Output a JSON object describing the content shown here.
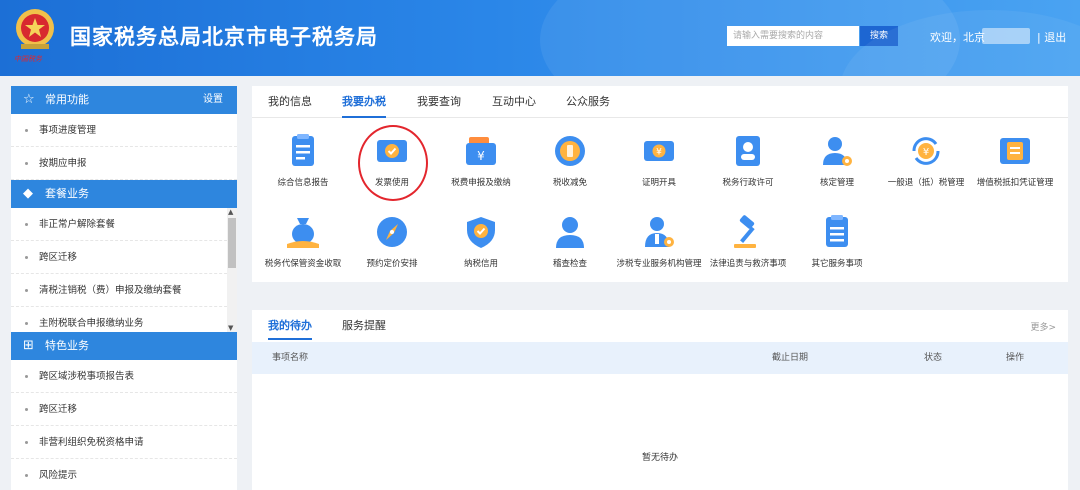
{
  "header": {
    "title": "国家税务总局北京市电子税务局",
    "search_placeholder": "请输入需要搜索的内容",
    "search_button": "搜索",
    "welcome": "欢迎，北京",
    "logout": "| 退出",
    "emblem_caption": "中国税务"
  },
  "sidebar": {
    "sections": [
      {
        "title": "常用功能",
        "icon": "star-icon",
        "setting": "设置",
        "items": [
          "事项进度管理",
          "按期应申报"
        ]
      },
      {
        "title": "套餐业务",
        "icon": "layers-icon",
        "items": [
          "非正常户解除套餐",
          "跨区迁移",
          "清税注销税（费）申报及缴纳套餐",
          "主附税联合申报缴纳业务"
        ]
      },
      {
        "title": "特色业务",
        "icon": "grid-icon",
        "items": [
          "跨区域涉税事项报告表",
          "跨区迁移",
          "非营利组织免税资格申请",
          "风险提示"
        ]
      }
    ]
  },
  "tabs": [
    "我的信息",
    "我要办税",
    "我要查询",
    "互动中心",
    "公众服务"
  ],
  "active_tab": "我要办税",
  "services_row1": [
    {
      "label": "综合信息报告",
      "icon": "report-icon"
    },
    {
      "label": "发票使用",
      "icon": "invoice-icon"
    },
    {
      "label": "税费申报及缴纳",
      "icon": "wallet-icon"
    },
    {
      "label": "税收减免",
      "icon": "coin-icon"
    },
    {
      "label": "证明开具",
      "icon": "certificate-icon"
    },
    {
      "label": "税务行政许可",
      "icon": "id-card-icon"
    },
    {
      "label": "核定管理",
      "icon": "user-gear-icon"
    },
    {
      "label": "一般退（抵）税管理",
      "icon": "refund-icon"
    },
    {
      "label": "增值税抵扣凭证管理",
      "icon": "ticket-icon"
    }
  ],
  "services_row2": [
    {
      "label": "税务代保管资金收取",
      "icon": "money-bag-icon"
    },
    {
      "label": "预约定价安排",
      "icon": "compass-icon"
    },
    {
      "label": "纳税信用",
      "icon": "shield-heart-icon"
    },
    {
      "label": "稽查检查",
      "icon": "inspector-icon"
    },
    {
      "label": "涉税专业服务机构管理",
      "icon": "org-gear-icon"
    },
    {
      "label": "法律追责与救济事项",
      "icon": "gavel-icon"
    },
    {
      "label": "其它服务事项",
      "icon": "document-list-icon"
    }
  ],
  "todo": {
    "tabs": [
      "我的待办",
      "服务提醒"
    ],
    "more": "更多>",
    "columns": [
      "事项名称",
      "截止日期",
      "状态",
      "操作"
    ],
    "empty_text": "暂无待办"
  },
  "colors": {
    "header_blue": "#2a86e8",
    "accent_blue": "#1f6fd8",
    "highlight_red": "#e3262d"
  }
}
